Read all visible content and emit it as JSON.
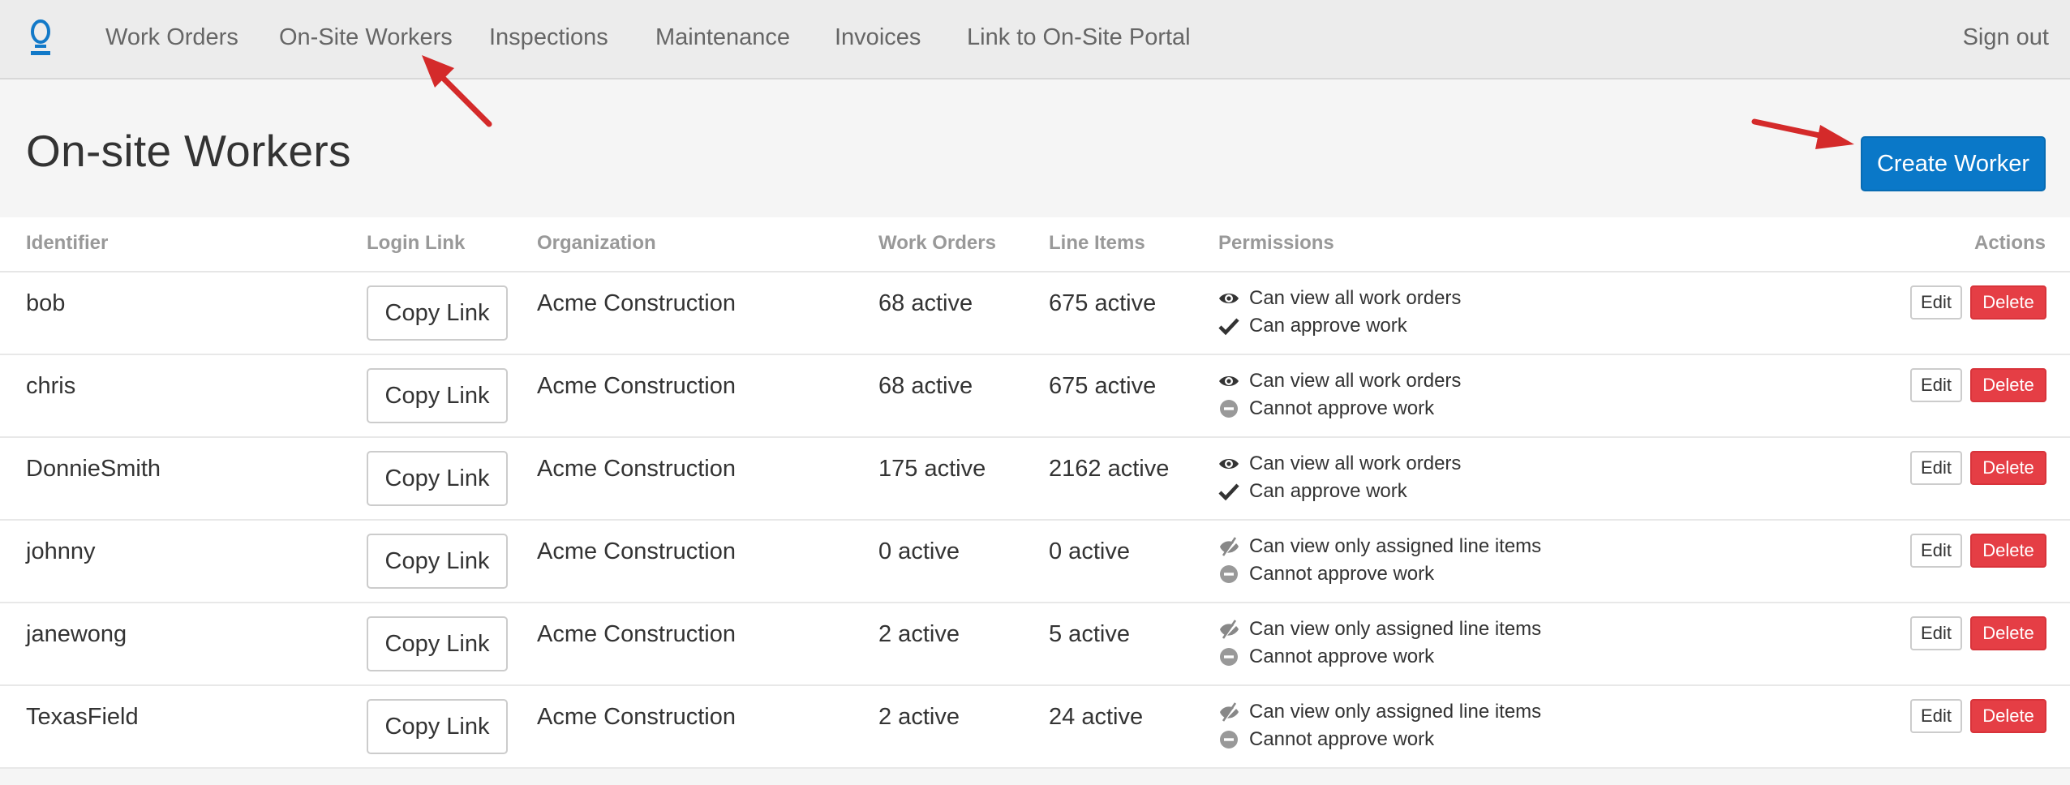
{
  "nav": {
    "brand_icon": "lightbulb-o-logo-icon",
    "items": [
      {
        "label": "Work Orders"
      },
      {
        "label": "On-Site Workers"
      },
      {
        "label": "Inspections"
      },
      {
        "label": "Maintenance"
      },
      {
        "label": "Invoices"
      },
      {
        "label": "Link to On-Site Portal"
      }
    ],
    "sign_out": "Sign out"
  },
  "header": {
    "title": "On-site Workers",
    "create_button": "Create Worker"
  },
  "table": {
    "columns": {
      "identifier": "Identifier",
      "login_link": "Login Link",
      "organization": "Organization",
      "work_orders": "Work Orders",
      "line_items": "Line Items",
      "permissions": "Permissions",
      "actions": "Actions"
    },
    "copy_label": "Copy Link",
    "edit_label": "Edit",
    "delete_label": "Delete",
    "rows": [
      {
        "identifier": "bob",
        "organization": "Acme Construction",
        "work_orders": "68 active",
        "line_items": "675 active",
        "perm1": {
          "icon": "eye-icon",
          "text": "Can view all work orders"
        },
        "perm2": {
          "icon": "check-icon",
          "text": "Can approve work"
        }
      },
      {
        "identifier": "chris",
        "organization": "Acme Construction",
        "work_orders": "68 active",
        "line_items": "675 active",
        "perm1": {
          "icon": "eye-icon",
          "text": "Can view all work orders"
        },
        "perm2": {
          "icon": "minus-circle-icon",
          "text": "Cannot approve work"
        }
      },
      {
        "identifier": "DonnieSmith",
        "organization": "Acme Construction",
        "work_orders": "175 active",
        "line_items": "2162 active",
        "perm1": {
          "icon": "eye-icon",
          "text": "Can view all work orders"
        },
        "perm2": {
          "icon": "check-icon",
          "text": "Can approve work"
        }
      },
      {
        "identifier": "johnny",
        "organization": "Acme Construction",
        "work_orders": "0 active",
        "line_items": "0 active",
        "perm1": {
          "icon": "eye-slash-icon",
          "text": "Can view only assigned line items"
        },
        "perm2": {
          "icon": "minus-circle-icon",
          "text": "Cannot approve work"
        }
      },
      {
        "identifier": "janewong",
        "organization": "Acme Construction",
        "work_orders": "2 active",
        "line_items": "5 active",
        "perm1": {
          "icon": "eye-slash-icon",
          "text": "Can view only assigned line items"
        },
        "perm2": {
          "icon": "minus-circle-icon",
          "text": "Cannot approve work"
        }
      },
      {
        "identifier": "TexasField",
        "organization": "Acme Construction",
        "work_orders": "2 active",
        "line_items": "24 active",
        "perm1": {
          "icon": "eye-slash-icon",
          "text": "Can view only assigned line items"
        },
        "perm2": {
          "icon": "minus-circle-icon",
          "text": "Cannot approve work"
        }
      }
    ]
  },
  "colors": {
    "primary": "#0a78c8",
    "danger": "#e53e45",
    "annotation_arrow": "#d42a2a"
  }
}
